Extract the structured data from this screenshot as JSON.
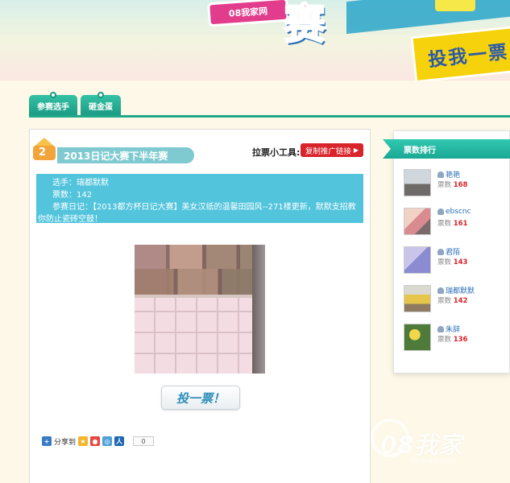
{
  "banner": {
    "logo_text": "08我家网",
    "big_char": "赛",
    "vote_slogan": "投我一票"
  },
  "tabs": [
    {
      "label": "参赛选手"
    },
    {
      "label": "砸金蛋"
    }
  ],
  "contest": {
    "crown_number": "2",
    "title": "2013日记大赛下半年赛",
    "tool_label": "拉票小工具:",
    "copy_link_label": "复制推广链接",
    "player_line": "选手：瑞都默默",
    "votes_line": "票数：142",
    "diary_line": "参赛日记：【2013都方杯日记大赛】美女汉纸的温馨田园风--271楼更新，默默支招教你防止瓷砖空鼓！",
    "vote_button": "投一票！",
    "share_label": "分享到",
    "share_count": "0"
  },
  "ranking": {
    "title": "票数排行",
    "votes_label": "票数",
    "items": [
      {
        "name": "艳艳",
        "votes": "168"
      },
      {
        "name": "ebscnc",
        "votes": "161"
      },
      {
        "name": "君陌",
        "votes": "143"
      },
      {
        "name": "瑞都默默",
        "votes": "142"
      },
      {
        "name": "朱辞",
        "votes": "136"
      }
    ]
  },
  "watermark": {
    "text": "08我家",
    "sub": "08wojia.com"
  },
  "colors": {
    "teal": "#1ea98a",
    "info_blue": "#52c4dc",
    "red": "#d8232a",
    "link_blue": "#2a6fb8"
  }
}
